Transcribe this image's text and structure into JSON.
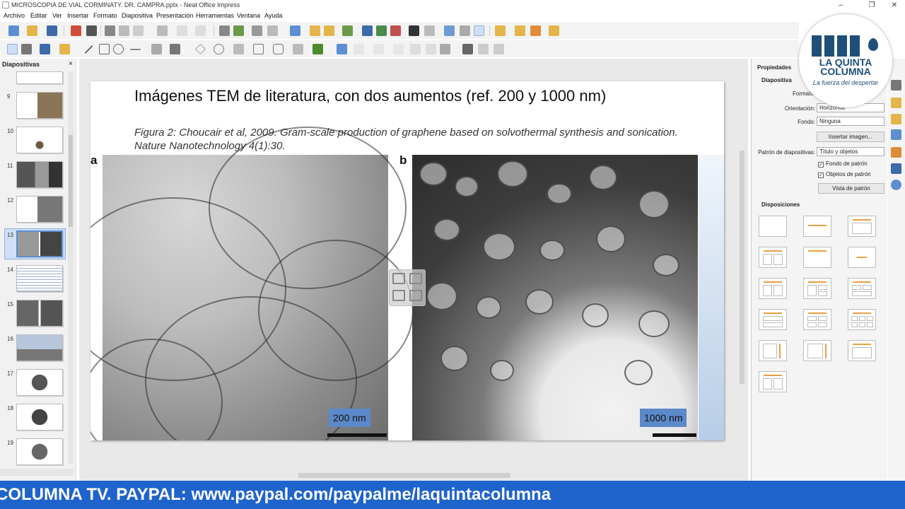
{
  "window": {
    "title": "MICROSCOPIA DE VIAL CORMINATY. DR. CAMPRA.pptx - Neat Office Impress",
    "controls": [
      "–",
      "❐",
      "✕"
    ]
  },
  "menu": [
    "Archivo",
    "Editar",
    "Ver",
    "Insertar",
    "Formato",
    "Diapositiva",
    "Presentación",
    "Herramientas",
    "Ventana",
    "Ayuda"
  ],
  "slides_panel": {
    "title": "Diapositivas",
    "close": "×",
    "thumbnails": [
      {
        "num": "9"
      },
      {
        "num": "10"
      },
      {
        "num": "11"
      },
      {
        "num": "12"
      },
      {
        "num": "13",
        "selected": true
      },
      {
        "num": "14"
      },
      {
        "num": "15"
      },
      {
        "num": "16"
      },
      {
        "num": "17"
      },
      {
        "num": "18"
      },
      {
        "num": "19"
      }
    ]
  },
  "slide": {
    "title": "Imágenes TEM de literatura, con dos aumentos (ref. 200 y 1000 nm)",
    "caption": "Figura 2: Choucair et al, 2009. Gram-scale production of graphene based on solvothermal synthesis and sonication. Nature Nanotechnology 4(1):30.",
    "panel_a_label": "a",
    "panel_b_label": "b",
    "scale_a": "200 nm",
    "scale_b": "1000 nm"
  },
  "sidebar": {
    "title": "Propiedades",
    "section_slide": "Diapositiva",
    "format_label": "Formato:",
    "orientation_label": "Orientación:",
    "orientation_value": "Horizontal",
    "background_label": "Fondo:",
    "background_value": "Ninguna",
    "insert_image": "Insertar imagen...",
    "master_label": "Patrón de diapositivas:",
    "master_value": "Título y objetos",
    "master_background": "Fondo de patrón",
    "master_objects": "Objetos de patrón",
    "master_view": "Vista de patrón",
    "section_layouts": "Disposiciones",
    "checkmark": "✓"
  },
  "logo": {
    "name": "LA QUINTA COLUMNA",
    "slogan": "La fuerza del despertar"
  },
  "ticker": "COLUMNA TV. PAYPAL: www.paypal.com/paypalme/laquintacolumna",
  "colors": {
    "ticker_bg": "#1f63cc",
    "scale_box": "#5b89c9",
    "selection": "#cfe0f5",
    "logo_blue": "#1d4f7a"
  }
}
